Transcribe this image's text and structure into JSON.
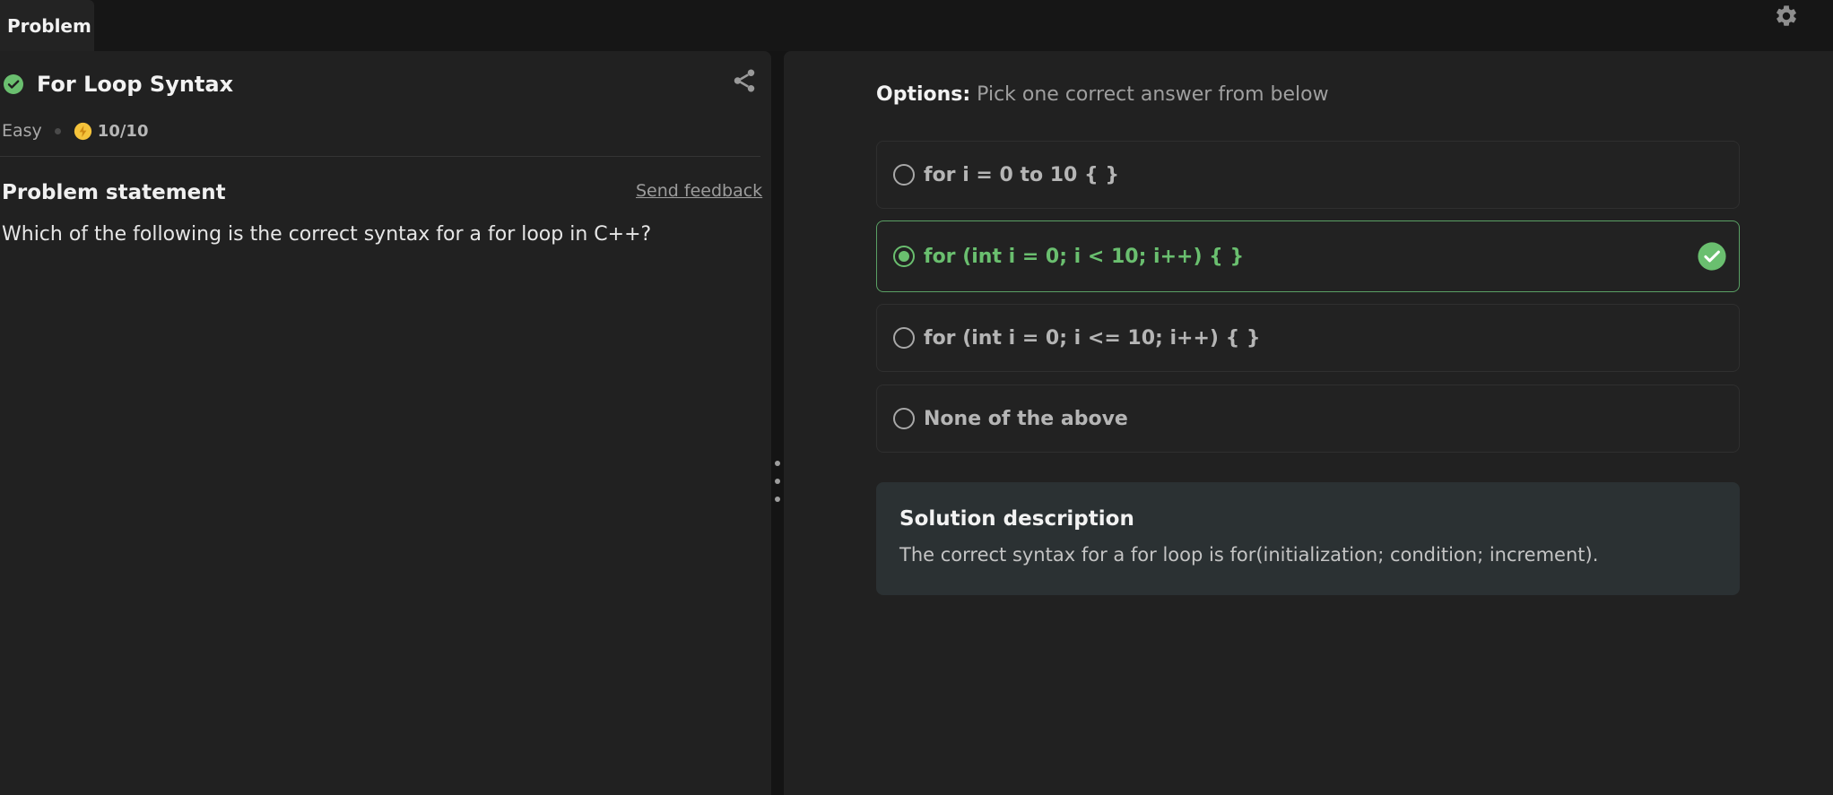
{
  "header": {
    "tab_label": "Problem",
    "settings_icon": "gear-icon"
  },
  "problem": {
    "title": "For Loop Syntax",
    "solved": true,
    "difficulty": "Easy",
    "score": "10/10",
    "statement_heading": "Problem statement",
    "feedback_label": "Send feedback",
    "question": "Which of the following is the correct syntax for a for loop in C++?"
  },
  "options_panel": {
    "heading_label": "Options:",
    "heading_sub": " Pick one correct answer from below",
    "options": [
      {
        "label": "for i = 0 to 10 { }",
        "selected": false,
        "correct": false
      },
      {
        "label": "for (int i = 0; i < 10; i++) { }",
        "selected": true,
        "correct": true
      },
      {
        "label": "for (int i = 0; i <= 10; i++) { }",
        "selected": false,
        "correct": false
      },
      {
        "label": "None of the above",
        "selected": false,
        "correct": false
      }
    ]
  },
  "solution": {
    "heading": "Solution description",
    "text": "The correct syntax for a for loop is for(initialization; condition; increment)."
  },
  "colors": {
    "accent_green": "#6abf6f",
    "score_yellow": "#f5c33b",
    "background": "#212121"
  }
}
